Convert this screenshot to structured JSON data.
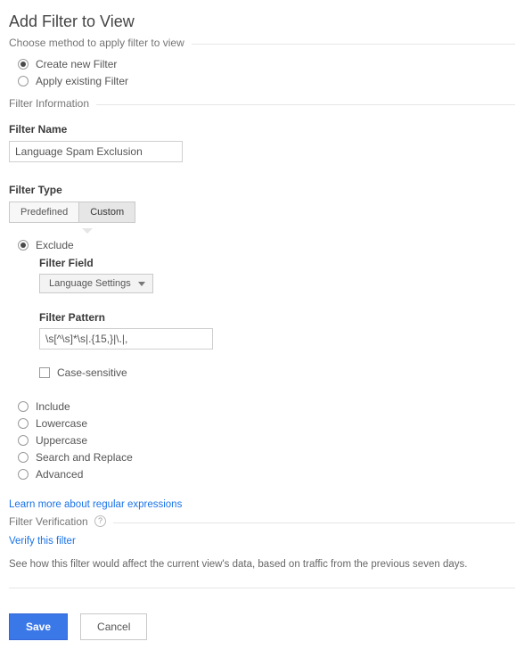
{
  "page_title": "Add Filter to View",
  "method_section": {
    "label": "Choose method to apply filter to view",
    "options": {
      "create_new": "Create new Filter",
      "apply_existing": "Apply existing Filter"
    },
    "selected": "create_new"
  },
  "filter_info": {
    "section_label": "Filter Information",
    "name_label": "Filter Name",
    "name_value": "Language Spam Exclusion",
    "type_label": "Filter Type",
    "tabs": {
      "predefined": "Predefined",
      "custom": "Custom"
    },
    "active_tab": "custom"
  },
  "custom_options": {
    "exclude": "Exclude",
    "include": "Include",
    "lowercase": "Lowercase",
    "uppercase": "Uppercase",
    "search_replace": "Search and Replace",
    "advanced": "Advanced",
    "selected": "exclude"
  },
  "exclude_block": {
    "field_label": "Filter Field",
    "field_value": "Language Settings",
    "pattern_label": "Filter Pattern",
    "pattern_value": "\\s[^\\s]*\\s|.{15,}|\\.|,",
    "case_sensitive": "Case-sensitive"
  },
  "regex_link": "Learn more about regular expressions",
  "verification": {
    "section_label": "Filter Verification",
    "verify_link": "Verify this filter",
    "help_text": "See how this filter would affect the current view's data, based on traffic from the previous seven days."
  },
  "buttons": {
    "save": "Save",
    "cancel": "Cancel"
  }
}
